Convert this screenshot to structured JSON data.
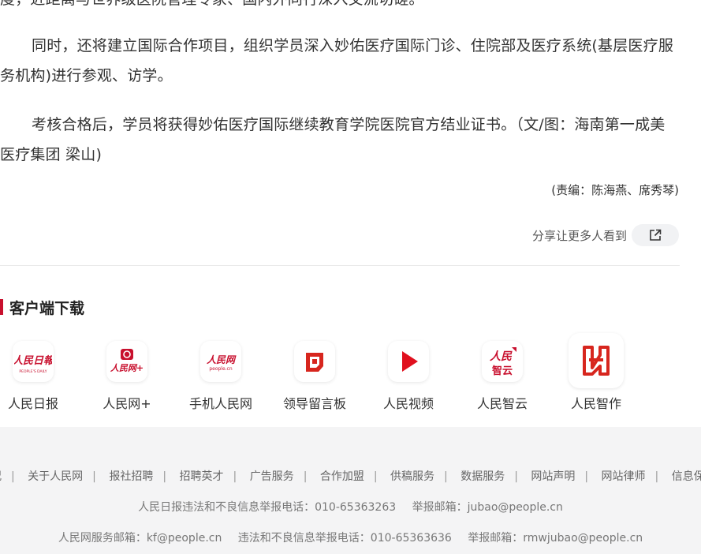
{
  "article": {
    "paragraphs": [
      "度，近距离与世界级医院管理专家、国内外同行深入交流切磋。",
      "同时，还将建立国际合作项目，组织学员深入妙佑医疗国际门诊、住院部及医疗系统(基层医疗服务机构)进行参观、访学。",
      "考核合格后，学员将获得妙佑医疗国际继续教育学院医院官方结业证书。（文/图：海南第一成美医疗集团 梁山)"
    ],
    "editor": "(责编：陈海燕、席秀琴)",
    "share_text": "分享让更多人看到"
  },
  "apps_section": {
    "title": "客户端下载",
    "apps": [
      {
        "label": "人民日报",
        "icon": "peoples-daily-icon"
      },
      {
        "label": "人民网+",
        "icon": "people-net-plus-icon"
      },
      {
        "label": "手机人民网",
        "icon": "mobile-people-net-icon"
      },
      {
        "label": "领导留言板",
        "icon": "leader-message-board-icon"
      },
      {
        "label": "人民视频",
        "icon": "people-video-icon"
      },
      {
        "label": "人民智云",
        "icon": "people-cloud-icon"
      },
      {
        "label": "人民智作",
        "icon": "people-create-icon"
      }
    ]
  },
  "footer": {
    "links": [
      "况",
      "关于人民网",
      "报社招聘",
      "招聘英才",
      "广告服务",
      "合作加盟",
      "供稿服务",
      "数据服务",
      "网站声明",
      "网站律师",
      "信息保护",
      ""
    ],
    "line1_a": "人民日报违法和不良信息举报电话：010-65363263",
    "line1_b": "举报邮箱：jubao@people.cn",
    "line2_a": "人民网服务邮箱：kf@people.cn",
    "line2_b": "违法和不良信息举报电话：010-65363636",
    "line2_c": "举报邮箱：rmwjubao@people.cn"
  },
  "colors": {
    "brand_red": "#c8102e",
    "footer_bg": "#f4f4f5"
  }
}
